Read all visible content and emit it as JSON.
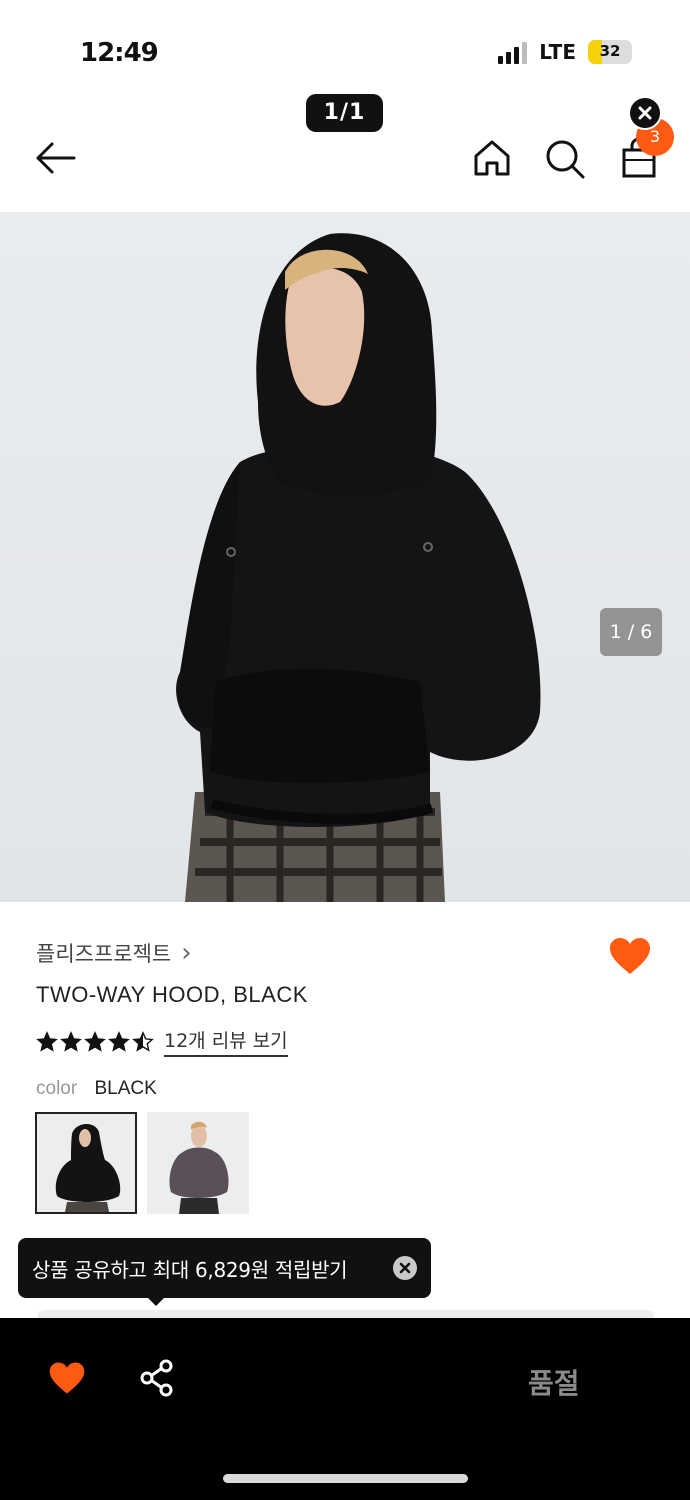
{
  "status_bar": {
    "time": "12:49",
    "network": "LTE",
    "battery": "32",
    "battery_level": 0.32
  },
  "header": {
    "page_counter": "1/1",
    "cart_count": "3",
    "icons": [
      "back-arrow-icon",
      "home-icon",
      "search-icon",
      "shopping-bag-icon",
      "close-icon"
    ]
  },
  "product": {
    "image_counter": "1 / 6",
    "brand": "플리즈프로젝트",
    "brand_chevron": "›",
    "title": "TWO-WAY HOOD, BLACK",
    "rating": 4.5,
    "rating_max": 5,
    "review_link": "12개 리뷰 보기",
    "color_label": "color",
    "color_value": "BLACK",
    "swatches": [
      "black",
      "charcoal"
    ],
    "wishlisted": true
  },
  "tooltip": {
    "text": "상품 공유하고 최대 6,829원 적립받기"
  },
  "bottom_bar": {
    "status": "품절"
  },
  "colors": {
    "accent": "#ff5a12",
    "dark": "#111111",
    "muted": "#8a8a8a"
  }
}
